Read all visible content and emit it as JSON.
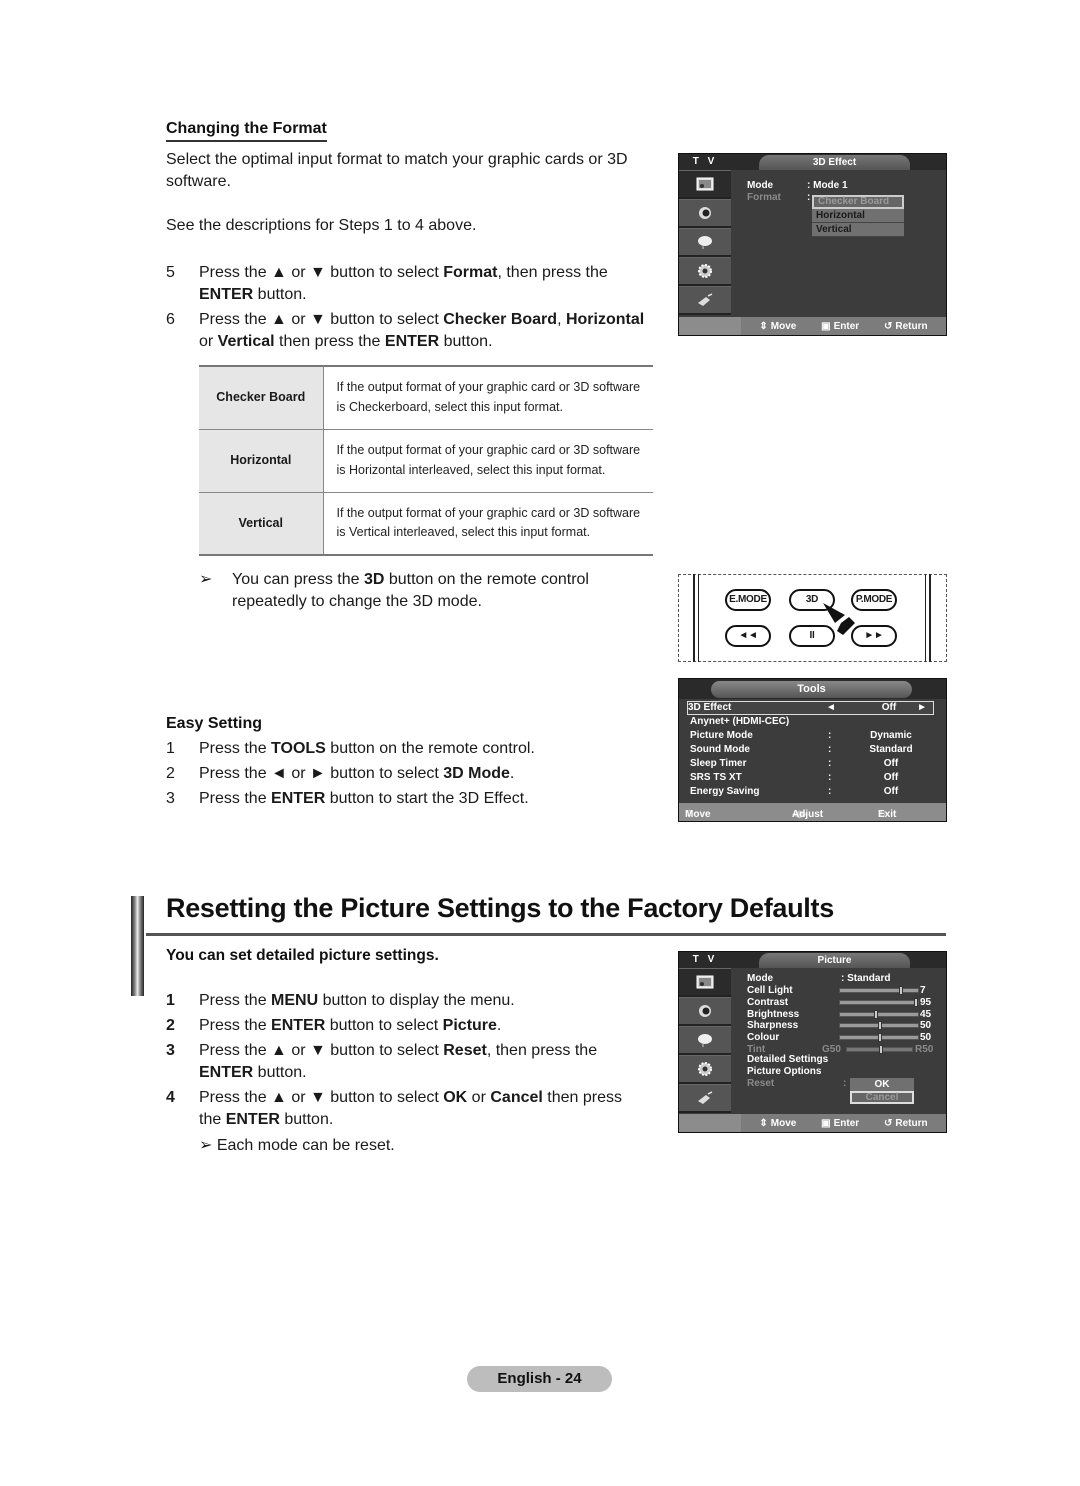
{
  "format_section": {
    "heading": "Changing the Format",
    "intro": "Select the optimal input format to match your graphic cards or 3D software.",
    "see_steps": "See the descriptions for Steps 1 to 4 above.",
    "steps": [
      {
        "num": "5",
        "parts": [
          "Press the ▲ or ▼ button to select ",
          "Format",
          ", then press the "
        ],
        "line2_bold": "ENTER",
        "line2_rest": " button."
      },
      {
        "num": "6",
        "parts": [
          "Press the ▲ or ▼ button to select ",
          "Checker Board",
          ", ",
          "Horizontal"
        ],
        "line2_pre": "or ",
        "line2_bold": "Vertical",
        "line2_mid": " then press the ",
        "line2_bold2": "ENTER",
        "line2_rest": " button."
      }
    ],
    "table": [
      {
        "key": "Checker Board",
        "desc": "If the output format of your graphic card or 3D software is Checkerboard, select this input format."
      },
      {
        "key": "Horizontal",
        "desc": "If the output format of your graphic card or 3D software is Horizontal interleaved, select this input format."
      },
      {
        "key": "Vertical",
        "desc": "If the output format of your graphic card or 3D software is Vertical interleaved, select this input format."
      }
    ],
    "note_pre": "You can press the ",
    "note_bold": "3D",
    "note_post": " button on the remote control",
    "note_line2": "repeatedly to change the 3D mode."
  },
  "easy_setting": {
    "heading": "Easy Setting",
    "steps": [
      {
        "num": "1",
        "pre": "Press the ",
        "bold": "TOOLS",
        "post": " button on the remote control."
      },
      {
        "num": "2",
        "pre": "Press the ◄ or ► button to select ",
        "bold": "3D Mode",
        "post": "."
      },
      {
        "num": "3",
        "pre": "Press the ",
        "bold": "ENTER",
        "post": " button to start the 3D Effect."
      }
    ]
  },
  "reset_section": {
    "title": "Resetting the Picture Settings to the Factory Defaults",
    "subtitle": "You can set detailed picture settings.",
    "steps": [
      {
        "num": "1",
        "pre": "Press the ",
        "bold": "MENU",
        "post": " button to display the menu."
      },
      {
        "num": "2",
        "pre": "Press the ",
        "bold": "ENTER",
        "post": " button to select ",
        "bold2": "Picture",
        "post2": "."
      },
      {
        "num": "3",
        "pre": "Press the ▲ or ▼ button to select ",
        "bold": "Reset",
        "post": ", then press the",
        "l2_bold": "ENTER",
        "l2_post": " button."
      },
      {
        "num": "4",
        "pre": "Press the ▲ or ▼ button to select ",
        "bold": "OK",
        "post": " or ",
        "bold2": "Cancel",
        "post2": " then press",
        "l2_pre": "the ",
        "l2_bold": "ENTER",
        "l2_post": " button."
      }
    ],
    "note": "Each mode can be reset."
  },
  "osd_3d": {
    "tv_label": "T V",
    "title": "3D Effect",
    "mode_label": "Mode",
    "mode_value": ": Mode 1",
    "format_label": "Format",
    "format_colon": ":",
    "options": [
      "Checker Board",
      "Horizontal",
      "Vertical"
    ],
    "selected_option": "Checker Board",
    "footer": {
      "move": "Move",
      "enter": "Enter",
      "return": "Return"
    }
  },
  "remote": {
    "buttons_row1": [
      "E.MODE",
      "3D",
      "P.MODE"
    ],
    "buttons_row2": [
      "◄◄",
      "II",
      "►►"
    ],
    "highlighted": "3D"
  },
  "osd_tools": {
    "title": "Tools",
    "rows": [
      {
        "label": "3D Effect",
        "sep": "◄",
        "value": "Off",
        "arrow": "►",
        "highlighted": true
      },
      {
        "label": "Anynet+ (HDMI-CEC)",
        "sep": "",
        "value": ""
      },
      {
        "label": "Picture Mode",
        "sep": ":",
        "value": "Dynamic"
      },
      {
        "label": "Sound Mode",
        "sep": ":",
        "value": "Standard"
      },
      {
        "label": "Sleep Timer",
        "sep": ":",
        "value": "Off"
      },
      {
        "label": "SRS TS XT",
        "sep": ":",
        "value": "Off"
      },
      {
        "label": "Energy Saving",
        "sep": ":",
        "value": "Off"
      }
    ],
    "footer": {
      "move": "Move",
      "adjust": "Adjust",
      "exit": "Exit"
    }
  },
  "osd_picture": {
    "tv_label": "T V",
    "title": "Picture",
    "mode_label": "Mode",
    "mode_value": ": Standard",
    "sliders": [
      {
        "label": "Cell Light",
        "value": "7",
        "fraction": 0.78,
        "dim": false
      },
      {
        "label": "Contrast",
        "value": "95",
        "fraction": 0.98,
        "dim": false
      },
      {
        "label": "Brightness",
        "value": "45",
        "fraction": 0.45,
        "dim": false
      },
      {
        "label": "Sharpness",
        "value": "50",
        "fraction": 0.5,
        "dim": false
      },
      {
        "label": "Colour",
        "value": "50",
        "fraction": 0.5,
        "dim": false
      },
      {
        "label": "Tint",
        "left": "G50",
        "value": "R50",
        "fraction": 0.5,
        "dim": true
      }
    ],
    "items": [
      "Detailed Settings",
      "Picture Options"
    ],
    "reset_label": "Reset",
    "reset_colon": ":",
    "reset_options": [
      "OK",
      "Cancel"
    ],
    "reset_selected": "Cancel",
    "footer": {
      "move": "Move",
      "enter": "Enter",
      "return": "Return"
    }
  },
  "page_footer": "English - 24"
}
